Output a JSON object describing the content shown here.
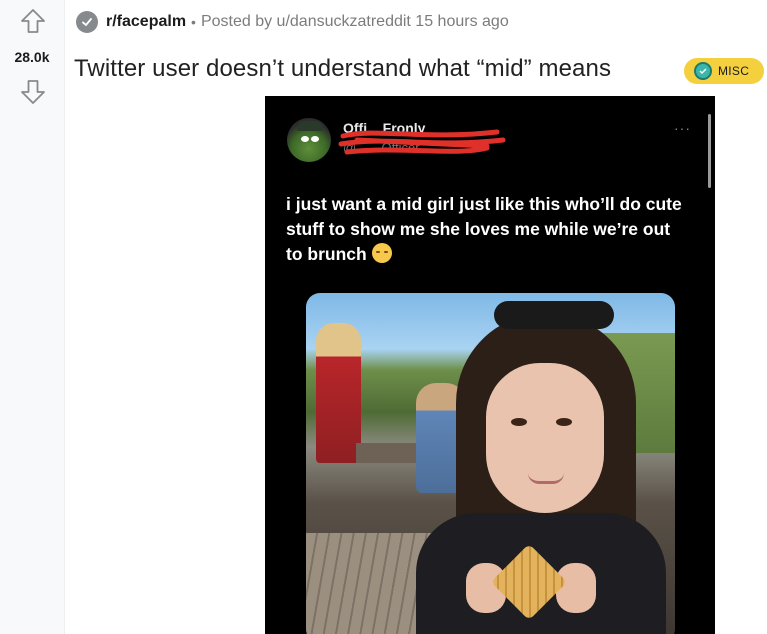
{
  "vote": {
    "count": "28.0k",
    "upvote_icon": "arrow-up-outline",
    "downvote_icon": "arrow-down-outline"
  },
  "post": {
    "subreddit": "r/facepalm",
    "separator": "•",
    "posted_by": "Posted by u/dansuckzatreddit 15 hours ago",
    "title": "Twitter user doesn’t understand what “mid” means",
    "flair": "MISC",
    "flair_color": "#f4d03f"
  },
  "media": {
    "tweet": {
      "name_obscured": "Offi... Fronly",
      "handle_obscured": "@.......Officer",
      "more": "···",
      "text": "i just want a mid girl just like this who’ll do cute stuff to show me she loves me while we’re out to brunch",
      "emoji": "pensive-face"
    }
  },
  "colors": {
    "vote_bg": "#f8f9fa",
    "accent_red": "#e0302a"
  }
}
